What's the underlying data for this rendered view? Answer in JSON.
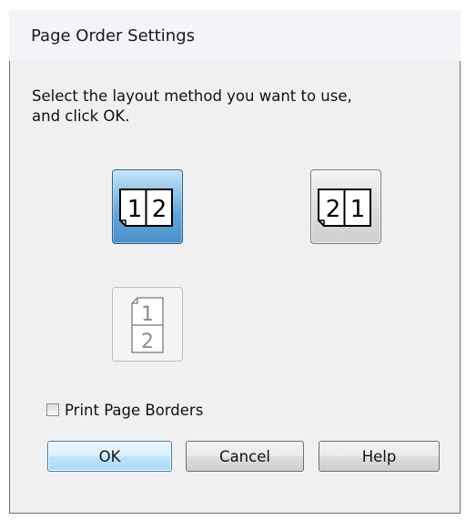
{
  "dialog": {
    "title": "Page Order Settings",
    "instruction_line1": "Select the layout method you want to use,",
    "instruction_line2": "and click OK."
  },
  "layouts": [
    {
      "icon": "left-to-right-pages-icon",
      "first": "1",
      "second": "2",
      "state": "selected"
    },
    {
      "icon": "right-to-left-pages-icon",
      "first": "2",
      "second": "1",
      "state": "normal"
    },
    {
      "icon": "top-to-bottom-pages-icon",
      "first": "1",
      "second": "2",
      "state": "disabled"
    }
  ],
  "print_page_borders": {
    "label": "Print Page Borders",
    "checked": false
  },
  "buttons": {
    "ok": "OK",
    "cancel": "Cancel",
    "help": "Help"
  }
}
